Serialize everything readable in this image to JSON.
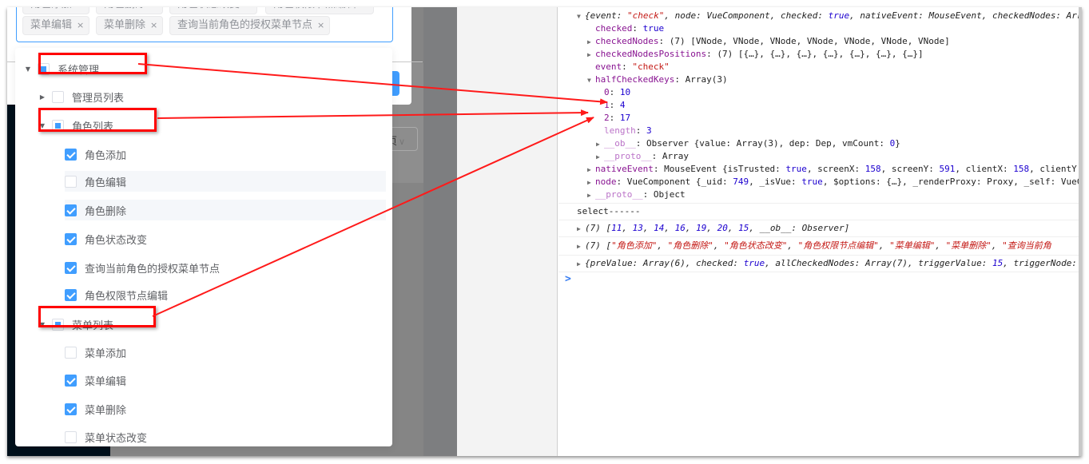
{
  "select_tags": {
    "row1": [
      "角色添加",
      "角色删除",
      "角色状态改变",
      "角色权限节点编辑"
    ],
    "row2": [
      "菜单编辑",
      "菜单删除",
      "查询当前角色的授权菜单节点"
    ],
    "close_glyph": "×"
  },
  "tree": {
    "nodes": [
      {
        "label": "系统管理",
        "level": 0,
        "expanded": true,
        "state": "half",
        "highlighted": true
      },
      {
        "label": "管理员列表",
        "level": 1,
        "expanded": false,
        "state": "unchecked"
      },
      {
        "label": "角色列表",
        "level": 1,
        "expanded": true,
        "state": "half",
        "highlighted": true
      },
      {
        "label": "角色添加",
        "level": 2,
        "state": "checked"
      },
      {
        "label": "角色编辑",
        "level": 2,
        "state": "unchecked"
      },
      {
        "label": "角色删除",
        "level": 2,
        "state": "checked"
      },
      {
        "label": "角色状态改变",
        "level": 2,
        "state": "checked"
      },
      {
        "label": "查询当前角色的授权菜单节点",
        "level": 2,
        "state": "checked"
      },
      {
        "label": "角色权限节点编辑",
        "level": 2,
        "state": "checked"
      },
      {
        "label": "菜单列表",
        "level": 1,
        "expanded": true,
        "state": "half",
        "highlighted": true
      },
      {
        "label": "菜单添加",
        "level": 2,
        "state": "unchecked"
      },
      {
        "label": "菜单编辑",
        "level": 2,
        "state": "checked"
      },
      {
        "label": "菜单删除",
        "level": 2,
        "state": "checked"
      },
      {
        "label": "菜单状态改变",
        "level": 2,
        "state": "unchecked"
      }
    ]
  },
  "background": {
    "pager_select_text": "页",
    "pager_chevron": "∨"
  },
  "console": {
    "obj_summary": {
      "open": "{event: ",
      "event_val": "\"check\"",
      "mid1": ", node: VueComponent, checked: ",
      "checked_val": "true",
      "mid2": ", nativeEvent: MouseEvent, checkedNodes: Arr"
    },
    "checked": {
      "key": "checked",
      "value": "true"
    },
    "checkedNodes": {
      "key": "checkedNodes",
      "value": "(7) [VNode, VNode, VNode, VNode, VNode, VNode, VNode]"
    },
    "checkedNodesPositions": {
      "key": "checkedNodesPositions",
      "value": "(7) [{…}, {…}, {…}, {…}, {…}, {…}, {…}]"
    },
    "event": {
      "key": "event",
      "value": "\"check\""
    },
    "halfCheckedKeys": {
      "key": "halfCheckedKeys",
      "value": "Array(3)"
    },
    "half_items": [
      {
        "key": "0",
        "value": "10"
      },
      {
        "key": "1",
        "value": "4"
      },
      {
        "key": "2",
        "value": "17"
      }
    ],
    "length": {
      "key": "length",
      "value": "3"
    },
    "ob": {
      "key": "__ob__",
      "pre": "Observer {value: Array(3), dep: Dep, vmCount: ",
      "num": "0",
      "post": "}"
    },
    "arr_proto": {
      "key": "__proto__",
      "value": "Array"
    },
    "nativeEvent": {
      "key": "nativeEvent",
      "pre": "MouseEvent {isTrusted: ",
      "t": "true",
      "a": ", screenX: ",
      "sx": "158",
      "b": ", screenY: ",
      "sy": "591",
      "c": ", clientX: ",
      "cx": "158",
      "d": ", clientY:"
    },
    "node": {
      "key": "node",
      "pre": "VueComponent {_uid: ",
      "uid": "749",
      "a": ", _isVue: ",
      "t": "true",
      "b": ", $options: {…}, _renderProxy: Proxy, _self: VueC"
    },
    "obj_proto": {
      "key": "__proto__",
      "value": "Object"
    },
    "select_log": "select------",
    "keys_log": {
      "pre": "(7) [",
      "values": [
        "11",
        "13",
        "14",
        "16",
        "19",
        "20",
        "15"
      ],
      "post": "__ob__: Observer]"
    },
    "labels_log": {
      "pre": "(7) [",
      "values": [
        "\"角色添加\"",
        "\"角色删除\"",
        "\"角色状态改变\"",
        "\"角色权限节点编辑\"",
        "\"菜单编辑\"",
        "\"菜单删除\"",
        "\"查询当前角"
      ]
    },
    "change_log": {
      "a": "{preValue: Array(6), checked: ",
      "t": "true",
      "b": ", allCheckedNodes: Array(7), triggerValue: ",
      "tv": "15",
      "c": ", triggerNode: "
    },
    "prompt": ">"
  },
  "annotation_color": "#ff0000",
  "accent_color": "#409eff"
}
